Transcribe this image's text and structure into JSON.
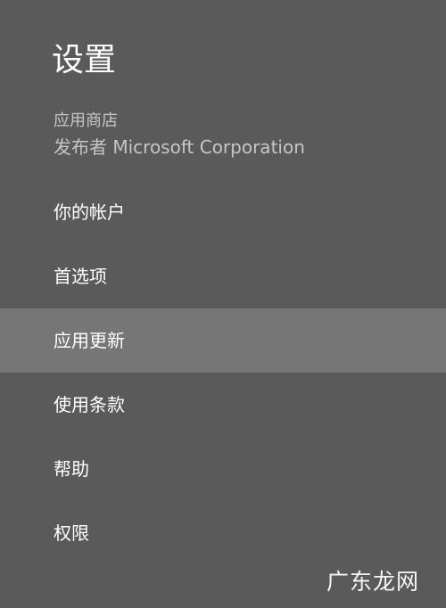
{
  "settings_pane": {
    "title": "设置",
    "app_name": "应用商店",
    "publisher": "发布者 Microsoft Corporation",
    "menu_items": [
      {
        "label": "你的帐户",
        "selected": false
      },
      {
        "label": "首选项",
        "selected": false
      },
      {
        "label": "应用更新",
        "selected": true
      },
      {
        "label": "使用条款",
        "selected": false
      },
      {
        "label": "帮助",
        "selected": false
      },
      {
        "label": "权限",
        "selected": false
      }
    ]
  },
  "watermark": {
    "text": "广东龙网"
  },
  "colors": {
    "pane_background": "#5a5a5a",
    "selected_background": "#767676",
    "primary_text": "#ffffff",
    "secondary_text": "#c6c6c6"
  }
}
